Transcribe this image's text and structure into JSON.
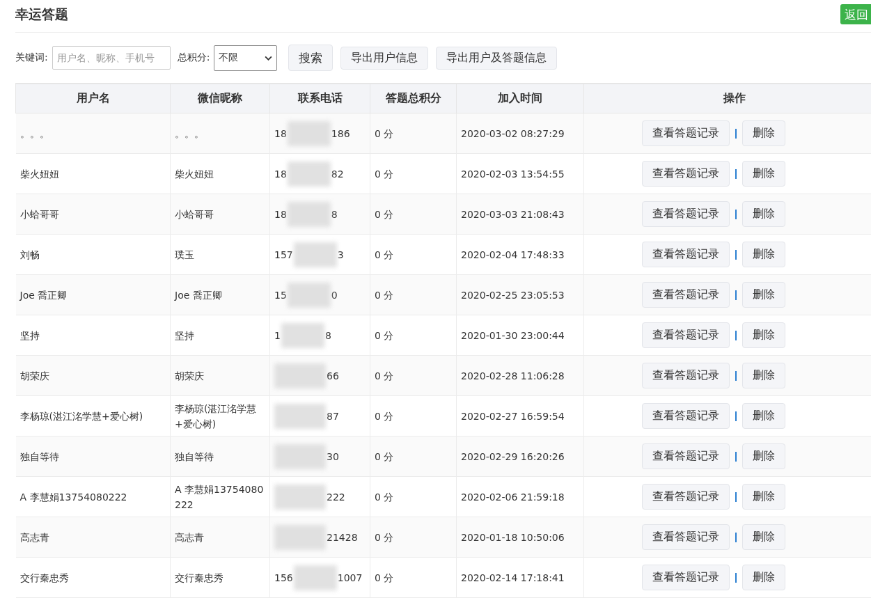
{
  "title": "幸运答题",
  "back_button": "返回",
  "filters": {
    "keyword_label": "关键词:",
    "keyword_placeholder": "用户名、昵称、手机号",
    "score_label": "总积分:",
    "score_value": "不限",
    "buttons": [
      "搜索",
      "导出用户信息",
      "导出用户及答题信息"
    ]
  },
  "table": {
    "columns": [
      "用户名",
      "微信昵称",
      "联系电话",
      "答题总积分",
      "加入时间",
      "操作"
    ],
    "rows": [
      {
        "username": "。。。",
        "nickname": "。。。",
        "phone_start": "18",
        "phone_end": "186",
        "score": "0 分",
        "joined": "2020-03-02 08:27:29",
        "actions": [
          "查看答题记录",
          "删除"
        ]
      },
      {
        "username": "柴火妞妞",
        "nickname": "柴火妞妞",
        "phone_start": "18",
        "phone_end": "82",
        "score": "0 分",
        "joined": "2020-02-03 13:54:55",
        "actions": [
          "查看答题记录",
          "删除"
        ]
      },
      {
        "username": "小蛤哥哥",
        "nickname": "小蛤哥哥",
        "phone_start": "18",
        "phone_end": "8",
        "score": "0 分",
        "joined": "2020-03-03 21:08:43",
        "actions": [
          "查看答题记录",
          "删除"
        ]
      },
      {
        "username": "刘畅",
        "nickname": "璞玉",
        "phone_start": "157",
        "phone_end": "3",
        "score": "0 分",
        "joined": "2020-02-04 17:48:33",
        "actions": [
          "查看答题记录",
          "删除"
        ]
      },
      {
        "username": "Joe 喬正卿",
        "nickname": "Joe 喬正卿",
        "phone_start": "15",
        "phone_end": "0",
        "score": "0 分",
        "joined": "2020-02-25 23:05:53",
        "actions": [
          "查看答题记录",
          "删除"
        ]
      },
      {
        "username": "坚持",
        "nickname": "坚持",
        "phone_start": "1",
        "phone_end": "8",
        "score": "0 分",
        "joined": "2020-01-30 23:00:44",
        "actions": [
          "查看答题记录",
          "删除"
        ]
      },
      {
        "username": "胡荣庆",
        "nickname": "胡荣庆",
        "phone_end": "66",
        "score": "0 分",
        "joined": "2020-02-28 11:06:28",
        "actions": [
          "查看答题记录",
          "删除"
        ]
      },
      {
        "username": "李杨琼(湛江洺学慧+爱心树)",
        "nickname": "李杨琼(湛江洺学慧+爱心树)",
        "phone_end": "87",
        "score": "0 分",
        "joined": "2020-02-27 16:59:54",
        "actions": [
          "查看答题记录",
          "删除"
        ]
      },
      {
        "username": "独自等待",
        "nickname": "独自等待",
        "phone_end": "30",
        "score": "0 分",
        "joined": "2020-02-29 16:20:26",
        "actions": [
          "查看答题记录",
          "删除"
        ]
      },
      {
        "username": "A 李慧娟13754080222",
        "nickname": "A 李慧娟13754080222",
        "phone_end": "222",
        "score": "0 分",
        "joined": "2020-02-06 21:59:18",
        "actions": [
          "查看答题记录",
          "删除"
        ]
      },
      {
        "username": "高志青",
        "nickname": "高志青",
        "phone_end": "21428",
        "score": "0 分",
        "joined": "2020-01-18 10:50:06",
        "actions": [
          "查看答题记录",
          "删除"
        ]
      },
      {
        "username": "交行秦忠秀",
        "nickname": "交行秦忠秀",
        "phone_start": "156",
        "phone_end": "1007",
        "score": "0 分",
        "joined": "2020-02-14 17:18:41",
        "actions": [
          "查看答题记录",
          "删除"
        ]
      }
    ]
  }
}
